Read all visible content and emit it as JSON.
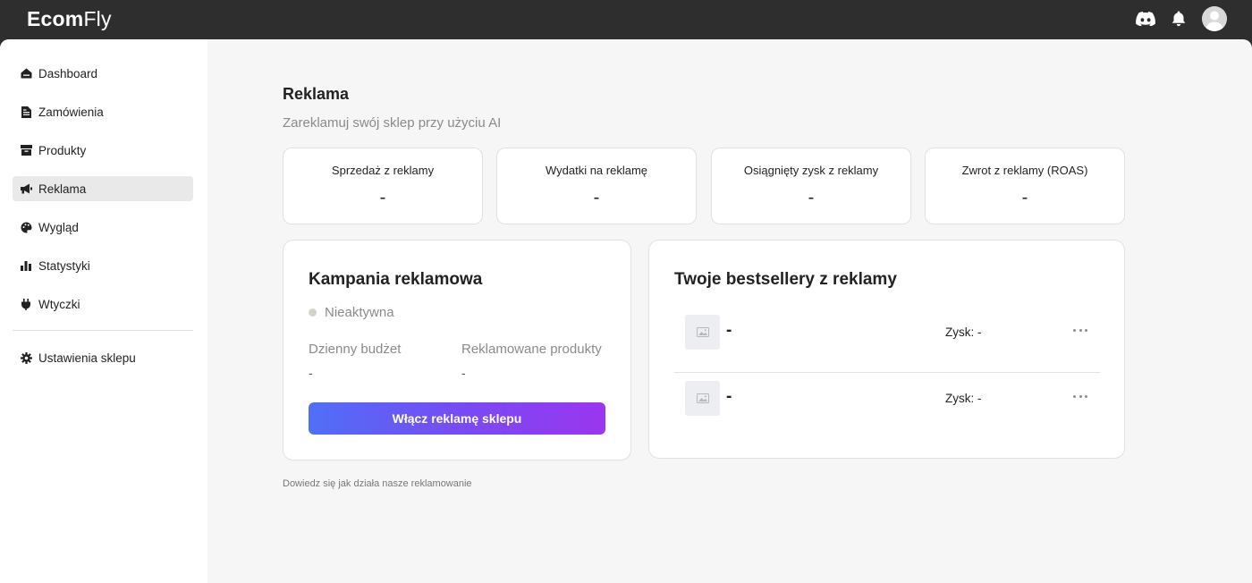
{
  "brand": {
    "part1": "Ecom",
    "part2": "Fly"
  },
  "topbar": {
    "icons": [
      "discord-icon",
      "bell-icon",
      "user-avatar-icon"
    ]
  },
  "sidebar": {
    "items": [
      {
        "label": "Dashboard",
        "icon": "home-icon"
      },
      {
        "label": "Zamówienia",
        "icon": "document-icon"
      },
      {
        "label": "Produkty",
        "icon": "box-icon"
      },
      {
        "label": "Reklama",
        "icon": "megaphone-icon",
        "active": true
      },
      {
        "label": "Wygląd",
        "icon": "palette-icon"
      },
      {
        "label": "Statystyki",
        "icon": "bar-chart-icon"
      },
      {
        "label": "Wtyczki",
        "icon": "plug-icon"
      }
    ],
    "settings": {
      "label": "Ustawienia sklepu",
      "icon": "gear-icon"
    }
  },
  "page": {
    "title": "Reklama",
    "subtitle": "Zareklamuj swój sklep przy użyciu AI"
  },
  "stats": [
    {
      "label": "Sprzedaż z reklamy",
      "value": "-"
    },
    {
      "label": "Wydatki na reklamę",
      "value": "-"
    },
    {
      "label": "Osiągnięty zysk z reklamy",
      "value": "-"
    },
    {
      "label": "Zwrot z reklamy (ROAS)",
      "value": "-"
    }
  ],
  "campaign": {
    "title": "Kampania reklamowa",
    "status": "Nieaktywna",
    "status_color": "#d3d3cc",
    "budget_label": "Dzienny budżet",
    "budget_value": "-",
    "products_label": "Reklamowane produkty",
    "products_value": "-",
    "cta_label": "Włącz reklamę sklepu",
    "cta_gradient": [
      "#4f6ff6",
      "#9b36ee"
    ]
  },
  "bestsellers": {
    "title": "Twoje bestsellery z reklamy",
    "items": [
      {
        "name": "-",
        "profit": "Zysk: -"
      },
      {
        "name": "-",
        "profit": "Zysk: -"
      }
    ]
  },
  "footer_link": "Dowiedz się jak działa nasze reklamowanie"
}
